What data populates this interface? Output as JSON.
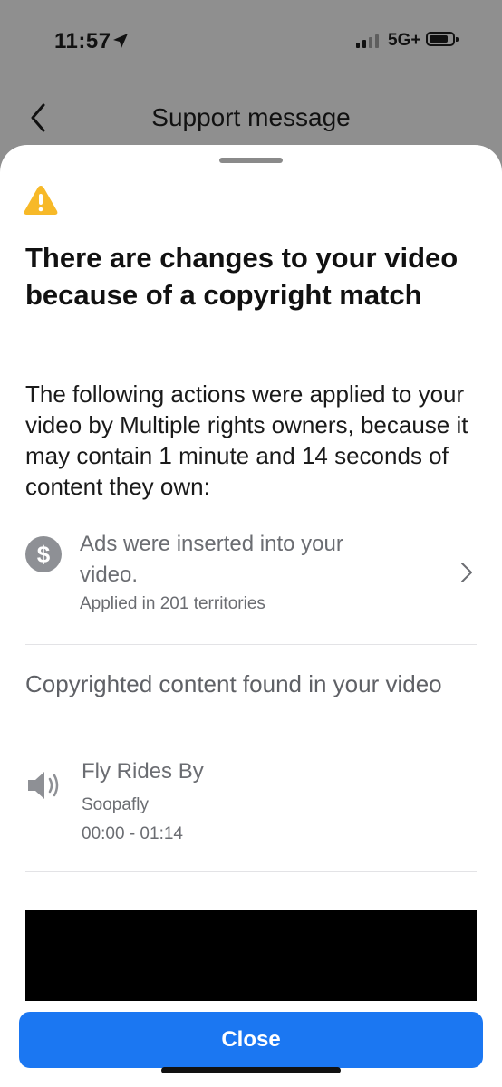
{
  "status_bar": {
    "time": "11:57",
    "network": "5G+"
  },
  "nav": {
    "title": "Support message"
  },
  "message": {
    "heading": "There are changes to your video because of a copyright match",
    "description": "The following actions were applied to your video by Multiple rights owners, because it may contain 1 minute and 14 seconds of content they own:"
  },
  "action": {
    "title": "Ads were inserted into your video.",
    "subtitle": "Applied in 201 territories",
    "icon": "dollar-icon"
  },
  "content_section": {
    "title": "Copyrighted content found in your video",
    "track": {
      "title": "Fly Rides By",
      "artist": "Soopafly",
      "time_range": "00:00 - 01:14",
      "icon": "speaker-icon"
    }
  },
  "footer": {
    "close_label": "Close"
  },
  "colors": {
    "accent": "#1b77f2",
    "warning": "#f7b928",
    "muted_text": "#6b6d72"
  }
}
